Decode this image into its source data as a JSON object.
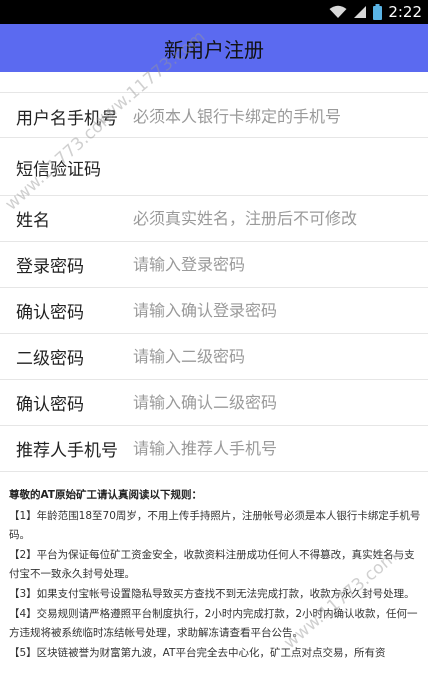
{
  "status_bar": {
    "time": "2:22",
    "icons": [
      "wifi-icon",
      "signal-icon",
      "battery-icon"
    ]
  },
  "app_bar": {
    "title": "新用户注册",
    "background": "#5b6af0"
  },
  "watermark": "www.11773.com",
  "form": {
    "fields": [
      {
        "label": "用户名手机号",
        "placeholder": "必须本人银行卡绑定的手机号"
      },
      {
        "label": "短信验证码",
        "placeholder": ""
      },
      {
        "label": "姓名",
        "placeholder": "必须真实姓名，注册后不可修改"
      },
      {
        "label": "登录密码",
        "placeholder": "请输入登录密码"
      },
      {
        "label": "确认密码",
        "placeholder": "请输入确认登录密码"
      },
      {
        "label": "二级密码",
        "placeholder": "请输入二级密码"
      },
      {
        "label": "确认密码",
        "placeholder": "请输入确认二级密码"
      },
      {
        "label": "推荐人手机号",
        "placeholder": "请输入推荐人手机号"
      }
    ]
  },
  "rules": {
    "title": "尊敬的AT原始矿工请认真阅读以下规则：",
    "items": [
      "【1】年龄范围18至70周岁，不用上传手持照片，注册帐号必须是本人银行卡绑定手机号码。",
      "【2】平台为保证每位矿工资金安全，收款资料注册成功任何人不得篡改，真实姓名与支付宝不一致永久封号处理。",
      "【3】如果支付宝帐号设置隐私导致买方查找不到无法完成打款，收款方永久封号处理。",
      "【4】交易规则请严格遵照平台制度执行，2小时内完成打款，2小时内确认收款，任何一方违规将被系统临时冻结帐号处理，求助解冻请查看平台公告。",
      "【5】区块链被誉为财富第九波，AT平台完全去中心化，矿工点对点交易，所有资"
    ]
  }
}
